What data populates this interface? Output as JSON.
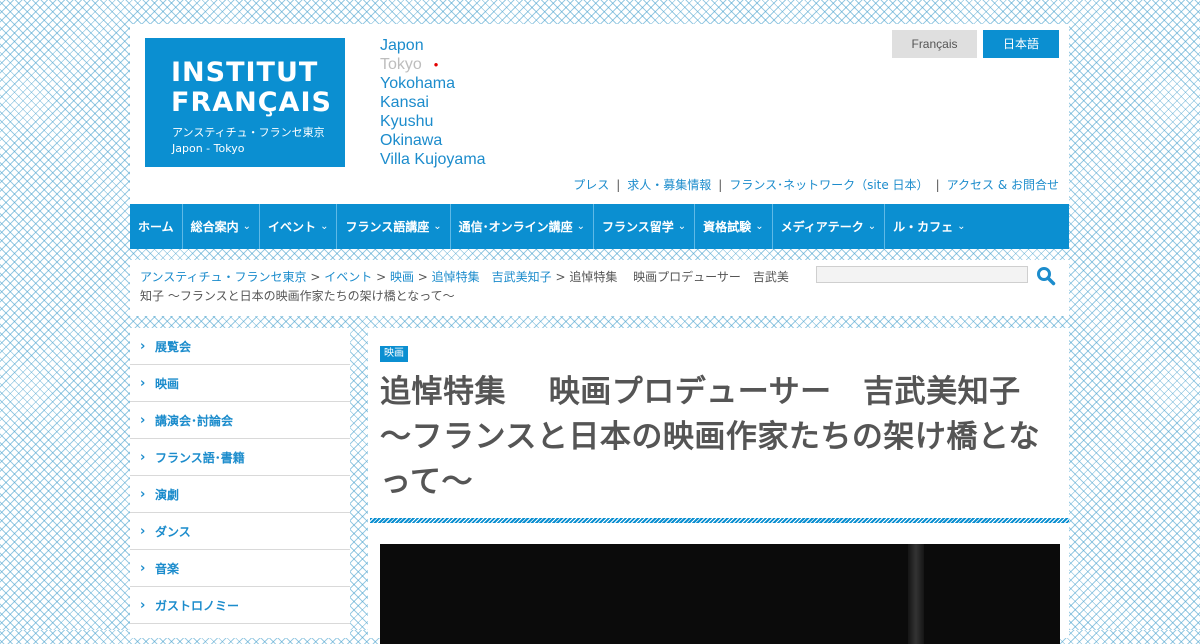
{
  "header": {
    "logo": {
      "line1": "INSTITUT",
      "line2": "FRANÇAIS",
      "subtitle": "アンスティチュ・フランセ東京",
      "location": "Japon - Tokyo"
    },
    "cities": [
      {
        "label": "Japon",
        "current": false
      },
      {
        "label": "Tokyo",
        "current": true
      },
      {
        "label": "Yokohama",
        "current": false
      },
      {
        "label": "Kansai",
        "current": false
      },
      {
        "label": "Kyushu",
        "current": false
      },
      {
        "label": "Okinawa",
        "current": false
      },
      {
        "label": "Villa Kujoyama",
        "current": false
      }
    ],
    "languages": {
      "fr": "Français",
      "ja": "日本語"
    },
    "util_links": [
      "プレス",
      "求人・募集情報",
      "フランス･ネットワーク（site 日本）",
      "アクセス & お問合せ"
    ],
    "separator": "|"
  },
  "nav": {
    "items": [
      {
        "label": "ホーム",
        "has_menu": false
      },
      {
        "label": "総合案内",
        "has_menu": true
      },
      {
        "label": "イベント",
        "has_menu": true
      },
      {
        "label": "フランス語講座",
        "has_menu": true
      },
      {
        "label": "通信･オンライン講座",
        "has_menu": true
      },
      {
        "label": "フランス留学",
        "has_menu": true
      },
      {
        "label": "資格試験",
        "has_menu": true
      },
      {
        "label": "メディアテーク",
        "has_menu": true
      },
      {
        "label": "ル・カフェ",
        "has_menu": true
      }
    ],
    "chevron": "⌄"
  },
  "breadcrumb": {
    "links": [
      "アンスティチュ・フランセ東京",
      "イベント",
      "映画",
      "追悼特集　吉武美知子"
    ],
    "separator": " > ",
    "current": "追悼特集　 映画プロデューサー　吉武美知子 ～フランスと日本の映画作家たちの架け橋となって～"
  },
  "search": {
    "placeholder": "",
    "icon": "magnifier-icon"
  },
  "sidebar": {
    "arrow": "›",
    "items": [
      "展覧会",
      "映画",
      "講演会･討論会",
      "フランス語･書籍",
      "演劇",
      "ダンス",
      "音楽",
      "ガストロノミー"
    ]
  },
  "article": {
    "category": "映画",
    "title": "追悼特集　 映画プロデューサー　吉武美知子 ～フランスと日本の映画作家たちの架け橋となって～"
  },
  "colors": {
    "brand_blue": "#0b8fd1",
    "link_blue": "#1c8ccc",
    "text_gray": "#555555"
  }
}
